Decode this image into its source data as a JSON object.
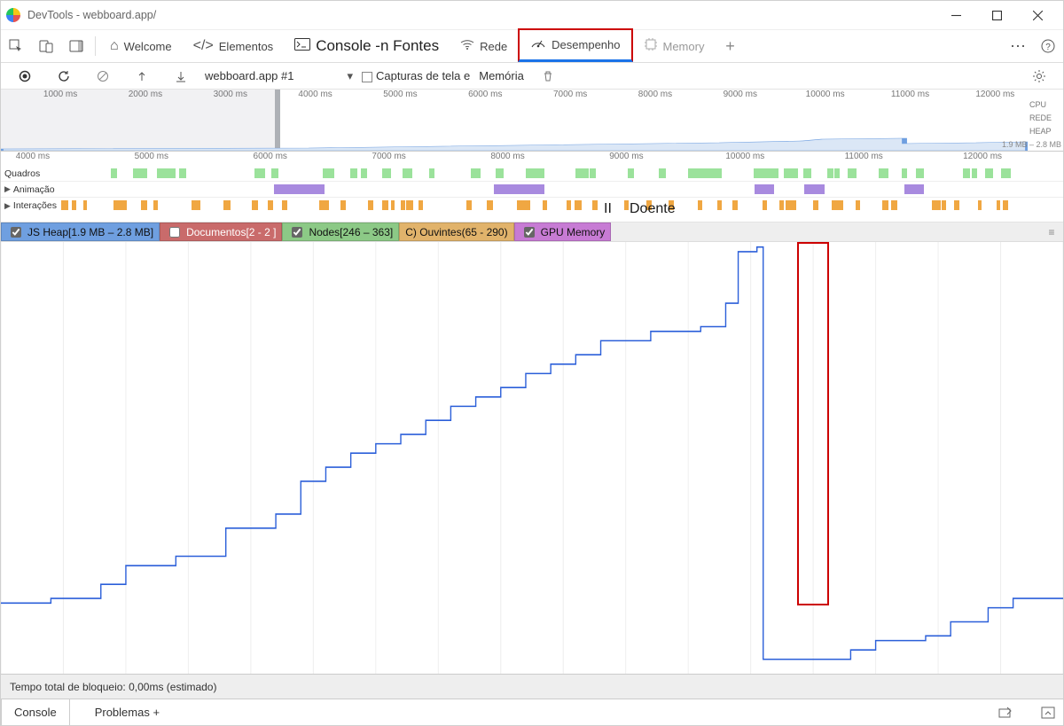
{
  "window": {
    "title": "DevTools - webboard.app/"
  },
  "tabs": {
    "welcome": "Welcome",
    "elements": "Elementos",
    "console": "Console -n Fontes",
    "network": "Rede",
    "performance": "Desempenho",
    "memory": "Memory"
  },
  "toolbar": {
    "target": "webboard.app #1",
    "screenshots": "Capturas de tela e",
    "memory": "Memória"
  },
  "overview": {
    "ticks": [
      "1000 ms",
      "2000 ms",
      "3000 ms",
      "4000 ms",
      "5000 ms",
      "6000 ms",
      "7000 ms",
      "8000 ms",
      "9000 ms",
      "10000 ms",
      "11000 ms",
      "12000 ms"
    ],
    "labels": {
      "cpu": "CPU",
      "net": "REDE",
      "heap": "HEAP"
    },
    "heap_range": "1.9 MB – 2.8 MB"
  },
  "flame": {
    "ticks": [
      "4000 ms",
      "5000 ms",
      "6000 ms",
      "7000 ms",
      "8000 ms",
      "9000 ms",
      "10000 ms",
      "11000 ms",
      "12000 ms"
    ],
    "rows": {
      "frames": "Quadros",
      "anim": "Animação",
      "inter": "Interações"
    },
    "overlay1": "II",
    "overlay2": "Doente"
  },
  "legend": {
    "jsheap": "JS Heap[1.9 MB – 2.8 MB]",
    "docs": "Documentos[2 - 2 ]",
    "nodes": "Nodes[246 – 363]",
    "listeners": "C) Ouvintes(65 - 290)",
    "gpu": "GPU Memory"
  },
  "footer": {
    "blocking": "Tempo total de bloqueio: 0,00ms (estimado)",
    "console": "Console",
    "problems": "Problemas +"
  },
  "chart_data": {
    "type": "line",
    "title": "JS Heap over time",
    "xlabel": "ms",
    "ylabel": "MB",
    "xlim": [
      4000,
      12500
    ],
    "ylim": [
      1.9,
      2.8
    ],
    "x": [
      4000,
      4400,
      4800,
      5000,
      5200,
      5400,
      5600,
      5800,
      6000,
      6200,
      6400,
      6600,
      6800,
      7000,
      7200,
      7400,
      7600,
      7800,
      8000,
      8200,
      8400,
      8600,
      8800,
      9000,
      9200,
      9400,
      9600,
      9800,
      9900,
      10000,
      10050,
      10100,
      10600,
      10800,
      11000,
      11400,
      11600,
      11900,
      12100,
      12500
    ],
    "values": [
      2.04,
      2.05,
      2.08,
      2.12,
      2.12,
      2.14,
      2.14,
      2.2,
      2.2,
      2.23,
      2.3,
      2.33,
      2.36,
      2.38,
      2.4,
      2.43,
      2.46,
      2.48,
      2.5,
      2.53,
      2.55,
      2.57,
      2.6,
      2.6,
      2.62,
      2.62,
      2.63,
      2.68,
      2.79,
      2.79,
      2.8,
      1.92,
      1.92,
      1.94,
      1.96,
      1.97,
      2.0,
      2.03,
      2.05,
      2.05
    ]
  }
}
